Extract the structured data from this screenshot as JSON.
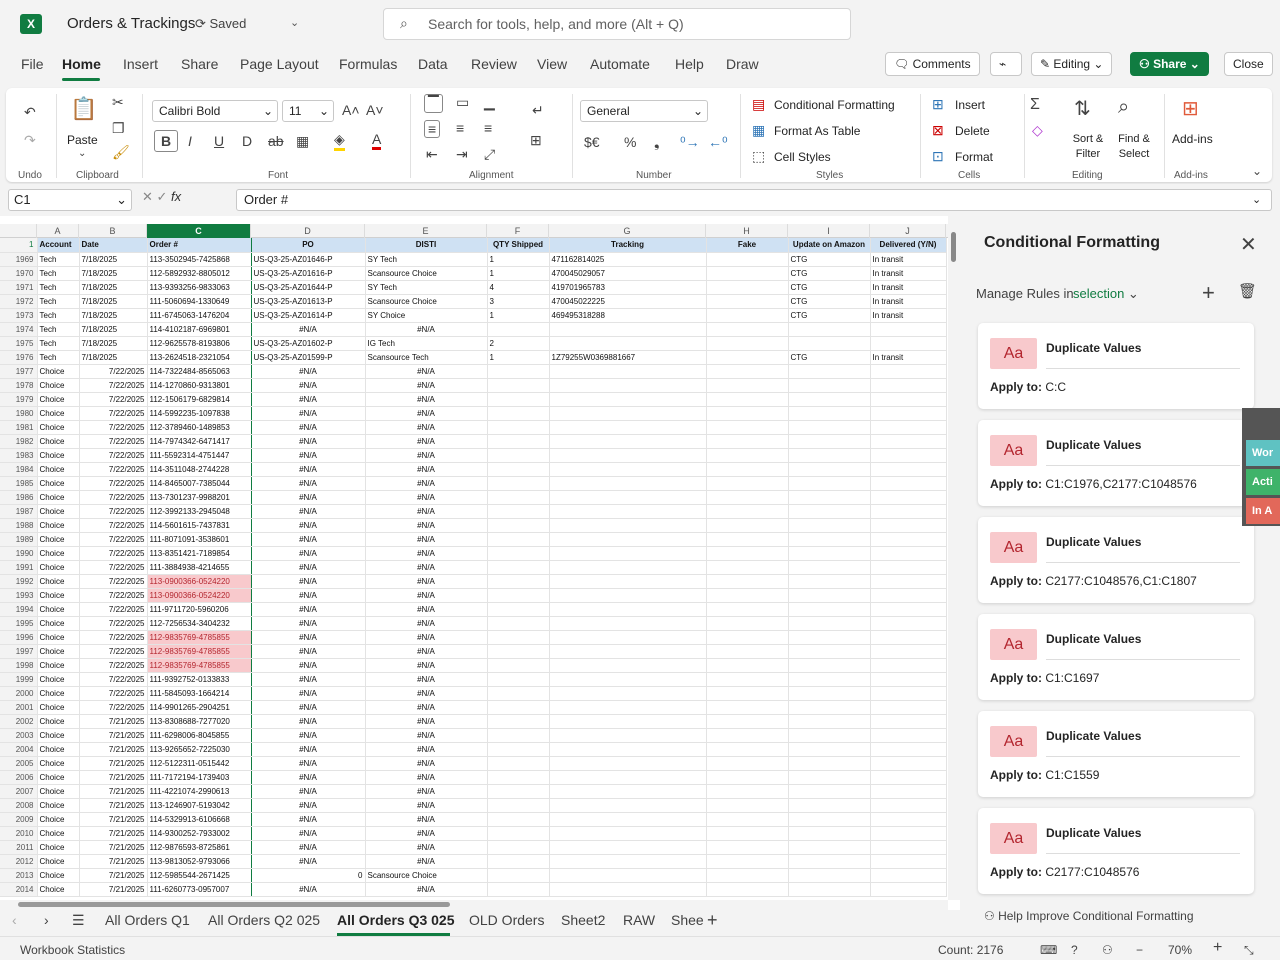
{
  "title_bar": {
    "title": "Orders & Trackings",
    "saved": "Saved",
    "search_placeholder": "Search for tools, help, and more (Alt + Q)"
  },
  "menu": {
    "items": [
      "File",
      "Home",
      "Insert",
      "Share",
      "Page Layout",
      "Formulas",
      "Data",
      "Review",
      "View",
      "Automate",
      "Help",
      "Draw"
    ],
    "comments": "Comments",
    "editing": "Editing",
    "share": "Share",
    "close": "Close"
  },
  "ribbon": {
    "groups": {
      "undo": "Undo",
      "clipboard": "Clipboard",
      "font": "Font",
      "alignment": "Alignment",
      "number": "Number",
      "styles": "Styles",
      "cells": "Cells",
      "editing": "Editing",
      "addins": "Add-ins"
    },
    "paste": "Paste",
    "font_name": "Calibri Bold",
    "font_size": "11",
    "number_format": "General",
    "conditional_formatting": "Conditional Formatting",
    "format_as_table": "Format As Table",
    "cell_styles": "Cell Styles",
    "insert": "Insert",
    "delete": "Delete",
    "format": "Format",
    "sort_filter": "Sort & Filter",
    "find_select": "Find & Select",
    "addins": "Add-ins"
  },
  "formula_bar": {
    "name_box": "C1",
    "formula": "Order #"
  },
  "columns": [
    "A",
    "B",
    "C",
    "D",
    "E",
    "F",
    "G",
    "H",
    "I",
    "J"
  ],
  "header_row": {
    "row": "1",
    "cells": [
      "Account",
      "Date",
      "Order #",
      "PO",
      "DISTI",
      "QTY Shipped",
      "Tracking",
      "Fake",
      "Update on Amazon",
      "Delivered (Y/N)"
    ]
  },
  "rows": [
    [
      "1969",
      "Tech",
      "7/18/2025",
      "113-3502945-7425868",
      "US-Q3-25-AZ01646-P",
      "SY Tech",
      "1",
      "471162814025",
      "",
      "CTG",
      "In transit"
    ],
    [
      "1970",
      "Tech",
      "7/18/2025",
      "112-5892932-8805012",
      "US-Q3-25-AZ01616-P",
      "Scansource Choice",
      "1",
      "470045029057",
      "",
      "CTG",
      "In transit"
    ],
    [
      "1971",
      "Tech",
      "7/18/2025",
      "113-9393256-9833063",
      "US-Q3-25-AZ01644-P",
      "SY Tech",
      "4",
      "419701965783",
      "",
      "CTG",
      "In transit"
    ],
    [
      "1972",
      "Tech",
      "7/18/2025",
      "111-5060694-1330649",
      "US-Q3-25-AZ01613-P",
      "Scansource Choice",
      "3",
      "470045022225",
      "",
      "CTG",
      "In transit"
    ],
    [
      "1973",
      "Tech",
      "7/18/2025",
      "111-6745063-1476204",
      "US-Q3-25-AZ01614-P",
      "SY Choice",
      "1",
      "469495318288",
      "",
      "CTG",
      "In transit"
    ],
    [
      "1974",
      "Tech",
      "7/18/2025",
      "114-4102187-6969801",
      "#N/A",
      "#N/A",
      "",
      "",
      "",
      "",
      ""
    ],
    [
      "1975",
      "Tech",
      "7/18/2025",
      "112-9625578-8193806",
      "US-Q3-25-AZ01602-P",
      "IG Tech",
      "2",
      "",
      "",
      "",
      ""
    ],
    [
      "1976",
      "Tech",
      "7/18/2025",
      "113-2624518-2321054",
      "US-Q3-25-AZ01599-P",
      "Scansource Tech",
      "1",
      "1Z79255W0369881667",
      "",
      "CTG",
      "In transit"
    ],
    [
      "1977",
      "Choice",
      "7/22/2025",
      "114-7322484-8565063",
      "#N/A",
      "#N/A",
      "",
      "",
      "",
      "",
      ""
    ],
    [
      "1978",
      "Choice",
      "7/22/2025",
      "114-1270860-9313801",
      "#N/A",
      "#N/A",
      "",
      "",
      "",
      "",
      ""
    ],
    [
      "1979",
      "Choice",
      "7/22/2025",
      "112-1506179-6829814",
      "#N/A",
      "#N/A",
      "",
      "",
      "",
      "",
      ""
    ],
    [
      "1980",
      "Choice",
      "7/22/2025",
      "114-5992235-1097838",
      "#N/A",
      "#N/A",
      "",
      "",
      "",
      "",
      ""
    ],
    [
      "1981",
      "Choice",
      "7/22/2025",
      "112-3789460-1489853",
      "#N/A",
      "#N/A",
      "",
      "",
      "",
      "",
      ""
    ],
    [
      "1982",
      "Choice",
      "7/22/2025",
      "114-7974342-6471417",
      "#N/A",
      "#N/A",
      "",
      "",
      "",
      "",
      ""
    ],
    [
      "1983",
      "Choice",
      "7/22/2025",
      "111-5592314-4751447",
      "#N/A",
      "#N/A",
      "",
      "",
      "",
      "",
      ""
    ],
    [
      "1984",
      "Choice",
      "7/22/2025",
      "114-3511048-2744228",
      "#N/A",
      "#N/A",
      "",
      "",
      "",
      "",
      ""
    ],
    [
      "1985",
      "Choice",
      "7/22/2025",
      "114-8465007-7385044",
      "#N/A",
      "#N/A",
      "",
      "",
      "",
      "",
      ""
    ],
    [
      "1986",
      "Choice",
      "7/22/2025",
      "113-7301237-9988201",
      "#N/A",
      "#N/A",
      "",
      "",
      "",
      "",
      ""
    ],
    [
      "1987",
      "Choice",
      "7/22/2025",
      "112-3992133-2945048",
      "#N/A",
      "#N/A",
      "",
      "",
      "",
      "",
      ""
    ],
    [
      "1988",
      "Choice",
      "7/22/2025",
      "114-5601615-7437831",
      "#N/A",
      "#N/A",
      "",
      "",
      "",
      "",
      ""
    ],
    [
      "1989",
      "Choice",
      "7/22/2025",
      "111-8071091-3538601",
      "#N/A",
      "#N/A",
      "",
      "",
      "",
      "",
      ""
    ],
    [
      "1990",
      "Choice",
      "7/22/2025",
      "113-8351421-7189854",
      "#N/A",
      "#N/A",
      "",
      "",
      "",
      "",
      ""
    ],
    [
      "1991",
      "Choice",
      "7/22/2025",
      "111-3884938-4214655",
      "#N/A",
      "#N/A",
      "",
      "",
      "",
      "",
      ""
    ],
    [
      "1992",
      "Choice",
      "7/22/2025",
      "113-0900366-0524220",
      "#N/A",
      "#N/A",
      "",
      "",
      "",
      "",
      ""
    ],
    [
      "1993",
      "Choice",
      "7/22/2025",
      "113-0900366-0524220",
      "#N/A",
      "#N/A",
      "",
      "",
      "",
      "",
      ""
    ],
    [
      "1994",
      "Choice",
      "7/22/2025",
      "111-9711720-5960206",
      "#N/A",
      "#N/A",
      "",
      "",
      "",
      "",
      ""
    ],
    [
      "1995",
      "Choice",
      "7/22/2025",
      "112-7256534-3404232",
      "#N/A",
      "#N/A",
      "",
      "",
      "",
      "",
      ""
    ],
    [
      "1996",
      "Choice",
      "7/22/2025",
      "112-9835769-4785855",
      "#N/A",
      "#N/A",
      "",
      "",
      "",
      "",
      ""
    ],
    [
      "1997",
      "Choice",
      "7/22/2025",
      "112-9835769-4785855",
      "#N/A",
      "#N/A",
      "",
      "",
      "",
      "",
      ""
    ],
    [
      "1998",
      "Choice",
      "7/22/2025",
      "112-9835769-4785855",
      "#N/A",
      "#N/A",
      "",
      "",
      "",
      "",
      ""
    ],
    [
      "1999",
      "Choice",
      "7/22/2025",
      "111-9392752-0133833",
      "#N/A",
      "#N/A",
      "",
      "",
      "",
      "",
      ""
    ],
    [
      "2000",
      "Choice",
      "7/22/2025",
      "111-5845093-1664214",
      "#N/A",
      "#N/A",
      "",
      "",
      "",
      "",
      ""
    ],
    [
      "2001",
      "Choice",
      "7/22/2025",
      "114-9901265-2904251",
      "#N/A",
      "#N/A",
      "",
      "",
      "",
      "",
      ""
    ],
    [
      "2002",
      "Choice",
      "7/21/2025",
      "113-8308688-7277020",
      "#N/A",
      "#N/A",
      "",
      "",
      "",
      "",
      ""
    ],
    [
      "2003",
      "Choice",
      "7/21/2025",
      "111-6298006-8045855",
      "#N/A",
      "#N/A",
      "",
      "",
      "",
      "",
      ""
    ],
    [
      "2004",
      "Choice",
      "7/21/2025",
      "113-9265652-7225030",
      "#N/A",
      "#N/A",
      "",
      "",
      "",
      "",
      ""
    ],
    [
      "2005",
      "Choice",
      "7/21/2025",
      "112-5122311-0515442",
      "#N/A",
      "#N/A",
      "",
      "",
      "",
      "",
      ""
    ],
    [
      "2006",
      "Choice",
      "7/21/2025",
      "111-7172194-1739403",
      "#N/A",
      "#N/A",
      "",
      "",
      "",
      "",
      ""
    ],
    [
      "2007",
      "Choice",
      "7/21/2025",
      "111-4221074-2990613",
      "#N/A",
      "#N/A",
      "",
      "",
      "",
      "",
      ""
    ],
    [
      "2008",
      "Choice",
      "7/21/2025",
      "113-1246907-5193042",
      "#N/A",
      "#N/A",
      "",
      "",
      "",
      "",
      ""
    ],
    [
      "2009",
      "Choice",
      "7/21/2025",
      "114-5329913-6106668",
      "#N/A",
      "#N/A",
      "",
      "",
      "",
      "",
      ""
    ],
    [
      "2010",
      "Choice",
      "7/21/2025",
      "114-9300252-7933002",
      "#N/A",
      "#N/A",
      "",
      "",
      "",
      "",
      ""
    ],
    [
      "2011",
      "Choice",
      "7/21/2025",
      "112-9876593-8725861",
      "#N/A",
      "#N/A",
      "",
      "",
      "",
      "",
      ""
    ],
    [
      "2012",
      "Choice",
      "7/21/2025",
      "113-9813052-9793066",
      "#N/A",
      "#N/A",
      "",
      "",
      "",
      "",
      ""
    ],
    [
      "2013",
      "Choice",
      "7/21/2025",
      "112-5985544-2671425",
      "0",
      "Scansource Choice",
      "",
      "",
      "",
      "",
      ""
    ],
    [
      "2014",
      "Choice",
      "7/21/2025",
      "111-6260773-0957007",
      "#N/A",
      "#N/A",
      "",
      "",
      "",
      "",
      ""
    ]
  ],
  "duplicate_rows": [
    "1992",
    "1993",
    "1996",
    "1997",
    "1998"
  ],
  "panel": {
    "title": "Conditional Formatting",
    "manage_label": "Manage Rules in",
    "manage_value": "selection",
    "swatch_text": "Aa",
    "apply_label": "Apply to:",
    "rules": [
      {
        "name": "Duplicate Values",
        "apply_to": "C:C"
      },
      {
        "name": "Duplicate Values",
        "apply_to": "C1:C1976,C2177:C1048576"
      },
      {
        "name": "Duplicate Values",
        "apply_to": "C2177:C1048576,C1:C1807"
      },
      {
        "name": "Duplicate Values",
        "apply_to": "C1:C1697"
      },
      {
        "name": "Duplicate Values",
        "apply_to": "C1:C1559"
      },
      {
        "name": "Duplicate Values",
        "apply_to": "C2177:C1048576"
      }
    ],
    "help": "Help Improve Conditional Formatting"
  },
  "floating_tab": {
    "items": [
      "Wor",
      "Acti",
      "In A"
    ]
  },
  "sheet_tabs": {
    "items": [
      "All Orders Q1",
      "All Orders Q2 025",
      "All Orders Q3 025",
      "OLD Orders",
      "Sheet2",
      "RAW",
      "Shee"
    ],
    "active": "All Orders Q3 025"
  },
  "status": {
    "left": "Workbook Statistics",
    "count": "Count: 2176",
    "zoom": "70%"
  },
  "colors": {
    "accent": "#107c41",
    "duplicate_fill": "#f8c9cc",
    "duplicate_text": "#b3262f",
    "header_fill": "#cfe1f3"
  }
}
